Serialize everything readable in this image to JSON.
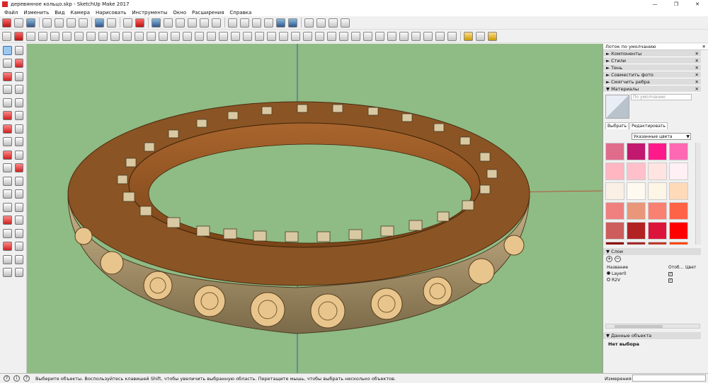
{
  "window": {
    "title": "деревянное кольцо.skp - SketchUp Make 2017",
    "min": "—",
    "max": "❐",
    "close": "✕"
  },
  "menu": [
    "Файл",
    "Изменить",
    "Вид",
    "Камера",
    "Нарисовать",
    "Инструменты",
    "Окно",
    "Расширения",
    "Справка"
  ],
  "tray": {
    "title": "Лоток по умолчанию",
    "close": "✕",
    "panels": [
      {
        "label": "Компоненты",
        "arrow": "►"
      },
      {
        "label": "Стили",
        "arrow": "►"
      },
      {
        "label": "Тень",
        "arrow": "►"
      },
      {
        "label": "Совместить фото",
        "arrow": "►"
      },
      {
        "label": "Смягчить ребра",
        "arrow": "►"
      },
      {
        "label": "Материалы",
        "arrow": "▼"
      }
    ],
    "materials": {
      "name_placeholder": "По умолчанию",
      "tab_select": "Выбрать",
      "tab_edit": "Редактировать",
      "dropdown_value": "Указанные цвета",
      "swatch_colors": [
        "#e06c8c",
        "#c2186f",
        "#ff1a8c",
        "#ff69b4",
        "#ffb6c1",
        "#ffc0cb",
        "#ffe4e1",
        "#fff0f5",
        "#faf0e6",
        "#fffaf0",
        "#fdf5e6",
        "#ffdab9",
        "#f08080",
        "#e9967a",
        "#fa8072",
        "#ff6347",
        "#cd5c5c",
        "#b22222",
        "#dc143c",
        "#ff0000",
        "#8b0000",
        "#a52a2a",
        "#c0392b",
        "#ff4500"
      ]
    },
    "layers": {
      "title": "Слои",
      "col_name": "Название",
      "col_visible": "Отоб...",
      "col_color": "Цвет",
      "rows": [
        {
          "name": "Layer0",
          "active": true,
          "visible": true
        },
        {
          "name": "R2V",
          "active": false,
          "visible": true
        }
      ]
    },
    "entity": {
      "title": "Данные объекта",
      "value": "Нет выбора"
    }
  },
  "status": {
    "text": "Выберите объекты. Воспользуйтесь клавишей Shift, чтобы увеличить выбранную область. Перетащите мышь, чтобы выбрать несколько объектов.",
    "measure_label": "Измерения"
  }
}
